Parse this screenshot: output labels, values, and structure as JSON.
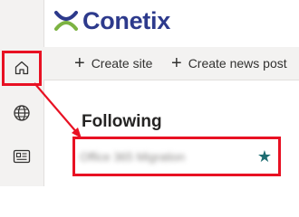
{
  "brand": {
    "name": "Conetix",
    "logo_icon": "conetix-logo-icon",
    "logo_color": "#2d3a8c",
    "accent_color": "#7cb342"
  },
  "rail": {
    "items": [
      {
        "icon": "home-icon"
      },
      {
        "icon": "globe-icon"
      },
      {
        "icon": "news-icon"
      }
    ]
  },
  "toolbar": {
    "create_site_label": "Create site",
    "create_news_post_label": "Create news post"
  },
  "following": {
    "heading": "Following",
    "sites": [
      {
        "name": "Office 365 Migration",
        "blurred": true,
        "favorite_icon": "star-filled-icon"
      }
    ]
  },
  "annotation": {
    "color": "#e81123"
  }
}
